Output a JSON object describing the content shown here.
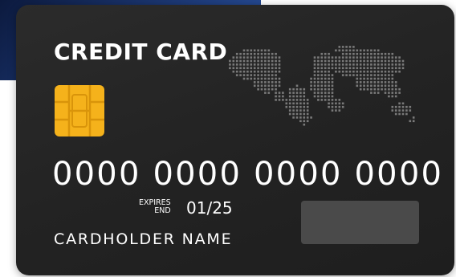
{
  "card": {
    "title": "CREDIT CARD",
    "number": "0000 0000 0000 0000",
    "expires_label_top": "EXPIRES",
    "expires_label_bottom": "END",
    "expiry": "01/25",
    "cardholder": "CARDHOLDER NAME"
  },
  "colors": {
    "card_background": "#262626",
    "chip": "#F5B21B",
    "text": "#FFFFFF",
    "map_dots": "#7A7A7A",
    "signature_panel": "#4A4A4A"
  },
  "icons": [
    "chip-icon",
    "world-map-icon"
  ]
}
